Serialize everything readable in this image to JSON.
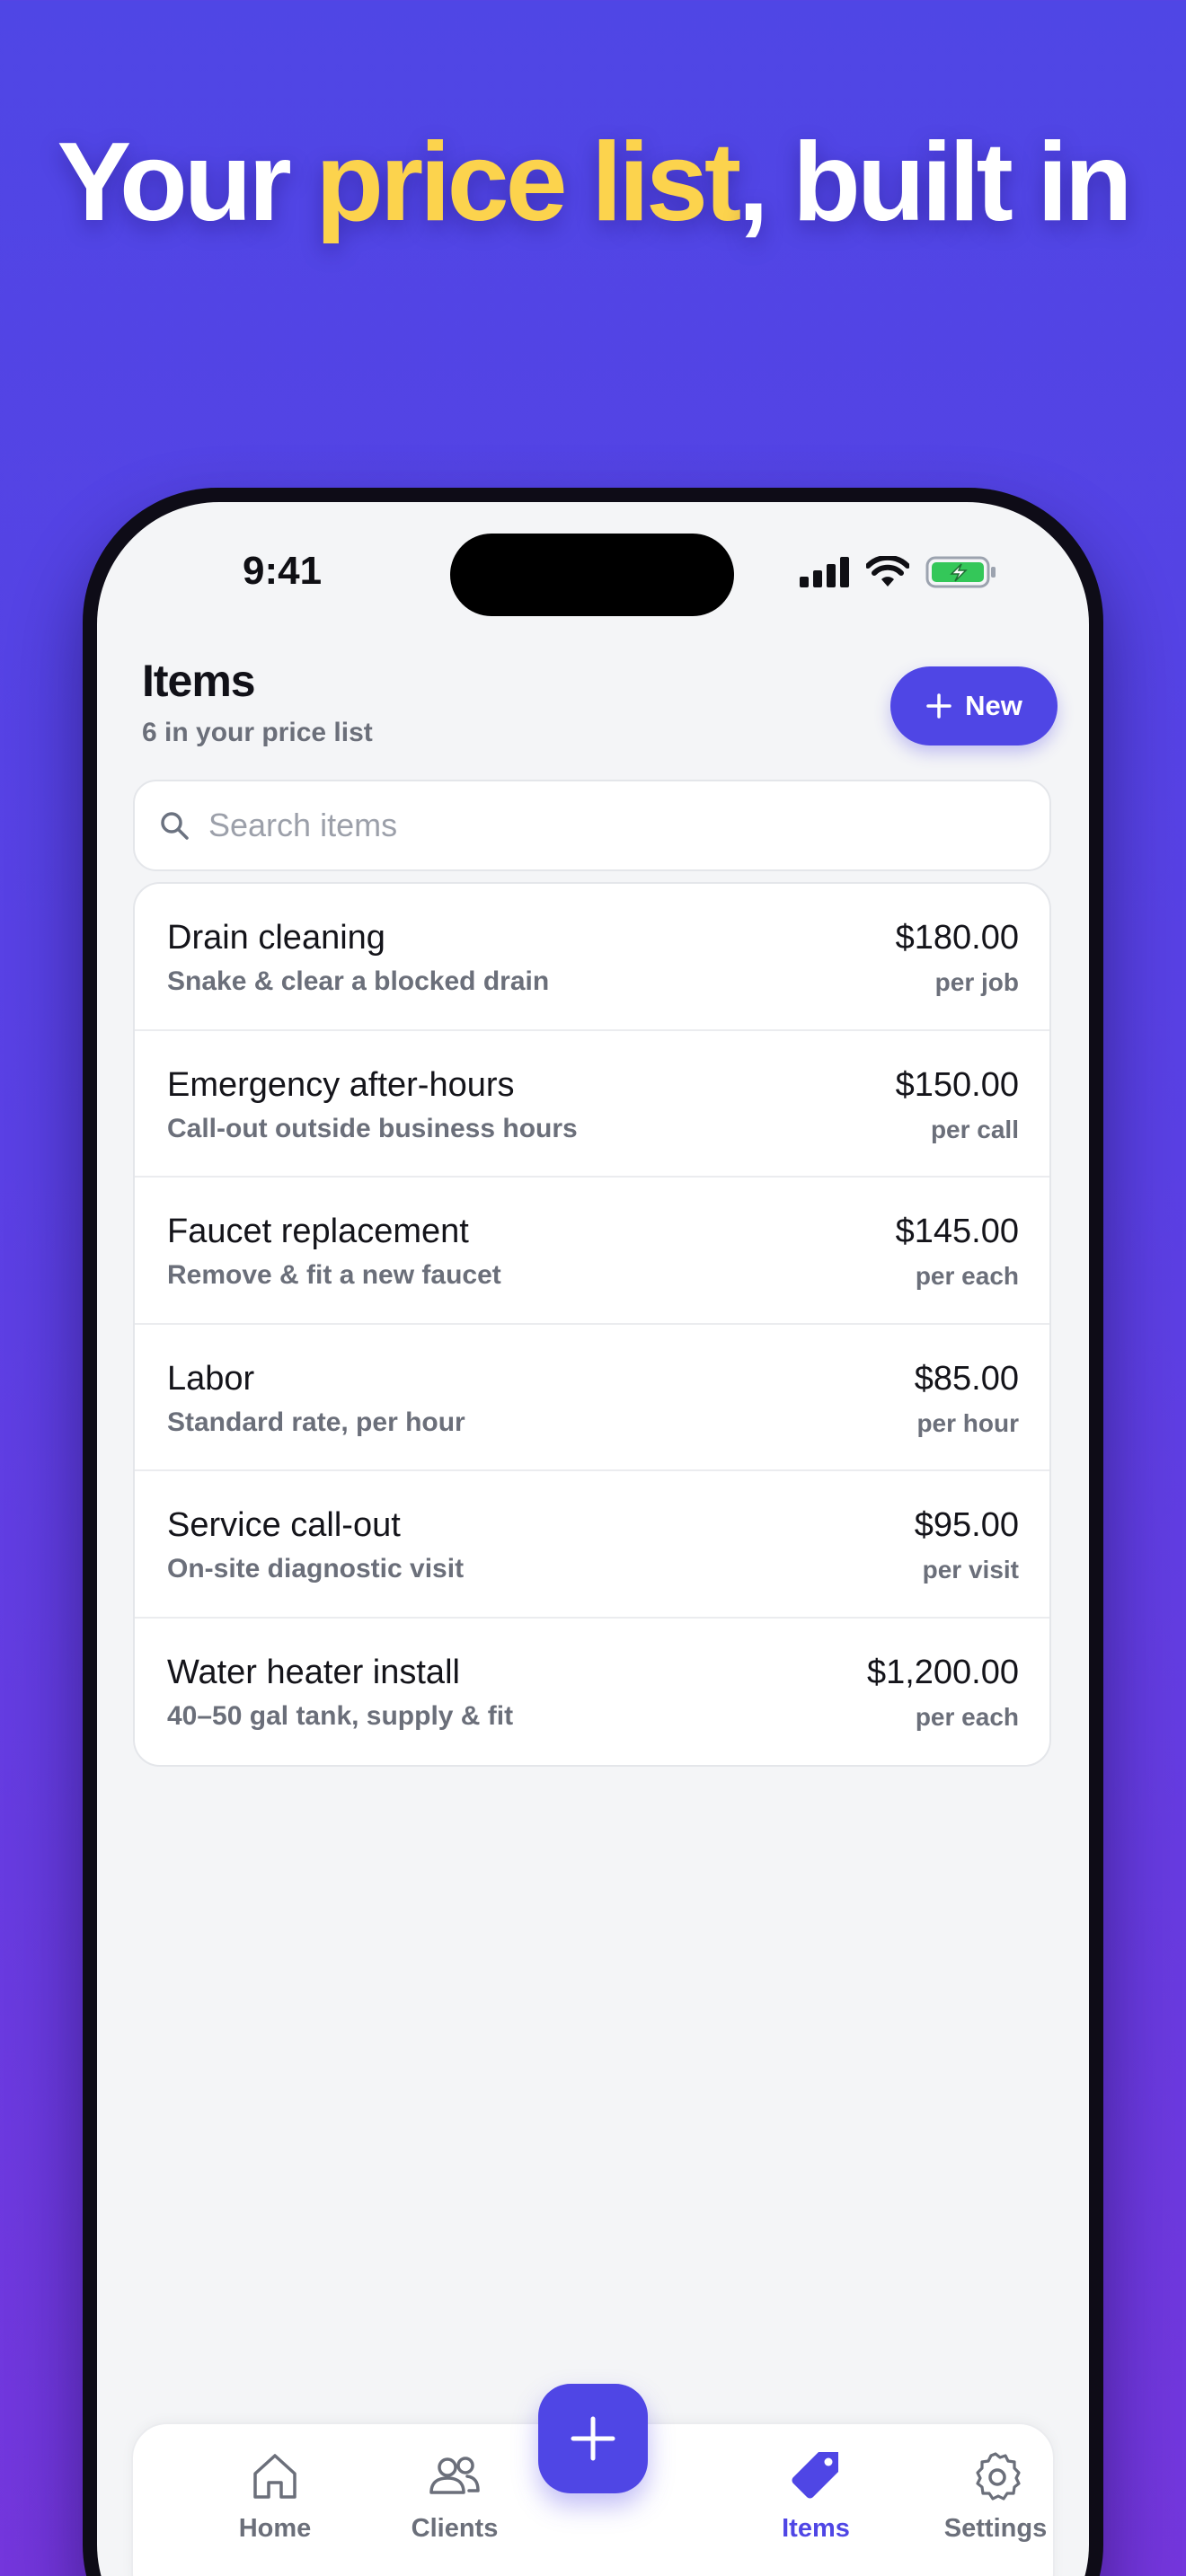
{
  "headline": {
    "before": "Your ",
    "highlight": "price list",
    "after": ", built in"
  },
  "status": {
    "time": "9:41"
  },
  "header": {
    "title": "Items",
    "subtitle": "6 in your price list",
    "new_label": "New"
  },
  "search": {
    "placeholder": "Search items"
  },
  "items": [
    {
      "name": "Drain cleaning",
      "description": "Snake & clear a blocked drain",
      "price": "$180.00",
      "unit": "per job"
    },
    {
      "name": "Emergency after-hours",
      "description": "Call-out outside business hours",
      "price": "$150.00",
      "unit": "per call"
    },
    {
      "name": "Faucet replacement",
      "description": "Remove & fit a new faucet",
      "price": "$145.00",
      "unit": "per each"
    },
    {
      "name": "Labor",
      "description": "Standard rate, per hour",
      "price": "$85.00",
      "unit": "per hour"
    },
    {
      "name": "Service call-out",
      "description": "On-site diagnostic visit",
      "price": "$95.00",
      "unit": "per visit"
    },
    {
      "name": "Water heater install",
      "description": "40–50 gal tank, supply & fit",
      "price": "$1,200.00",
      "unit": "per each"
    }
  ],
  "tabs": [
    {
      "label": "Home",
      "icon": "home-icon"
    },
    {
      "label": "Clients",
      "icon": "users-icon"
    },
    {
      "label": "Items",
      "icon": "tag-icon",
      "active": true
    },
    {
      "label": "Settings",
      "icon": "gear-icon"
    }
  ],
  "colors": {
    "accent": "#4f46e5",
    "highlight": "#fcd34d",
    "battery": "#34c759"
  }
}
